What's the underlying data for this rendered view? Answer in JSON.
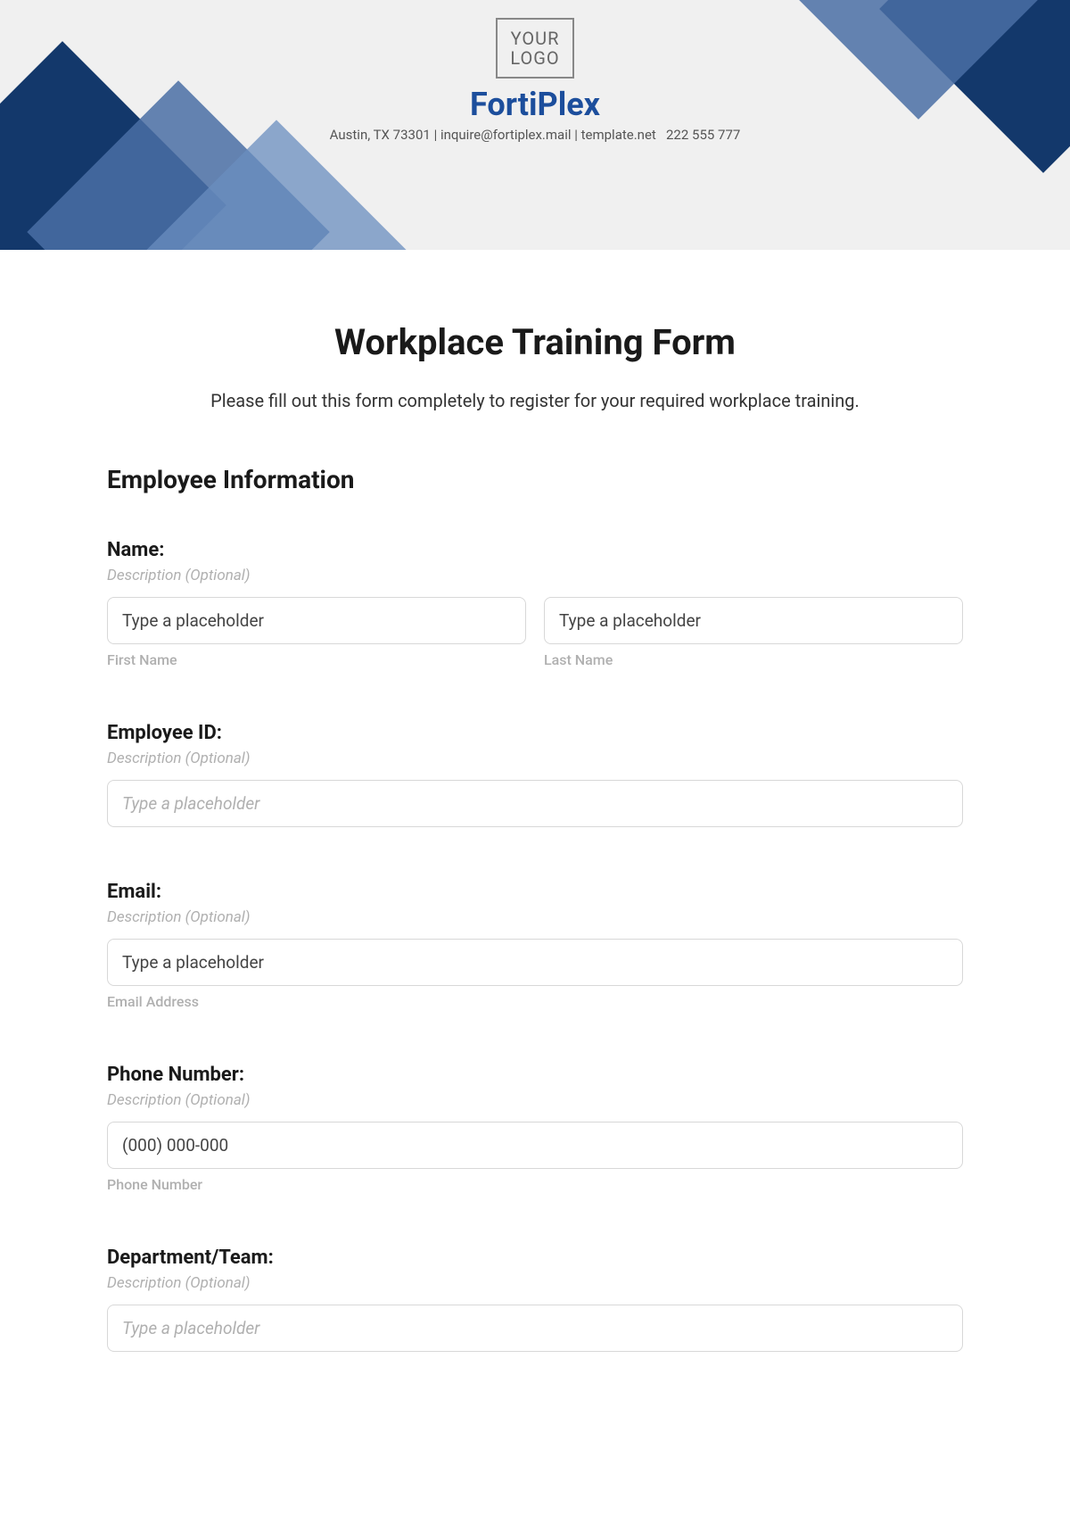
{
  "header": {
    "logo_line1": "YOUR",
    "logo_line2": "LOGO",
    "company": "FortiPlex",
    "address": "Austin, TX 73301",
    "email": "inquire@fortiplex.mail",
    "site": "template.net",
    "phone": "222 555 777"
  },
  "form": {
    "title": "Workplace Training Form",
    "instructions": "Please fill out this form completely to register for your required workplace training.",
    "section_heading": "Employee Information",
    "fields": {
      "name": {
        "label": "Name:",
        "desc": "Description (Optional)",
        "first_placeholder": "Type a placeholder",
        "first_sublabel": "First Name",
        "last_placeholder": "Type a placeholder",
        "last_sublabel": "Last Name"
      },
      "employee_id": {
        "label": "Employee ID:",
        "desc": "Description (Optional)",
        "placeholder": "Type a placeholder"
      },
      "email": {
        "label": "Email:",
        "desc": "Description (Optional)",
        "placeholder": "Type a placeholder",
        "sublabel": "Email Address"
      },
      "phone": {
        "label": "Phone Number:",
        "desc": "Description (Optional)",
        "placeholder": "(000) 000-000",
        "sublabel": "Phone Number"
      },
      "department": {
        "label": "Department/Team:",
        "desc": "Description (Optional)",
        "placeholder": "Type a placeholder"
      }
    }
  }
}
